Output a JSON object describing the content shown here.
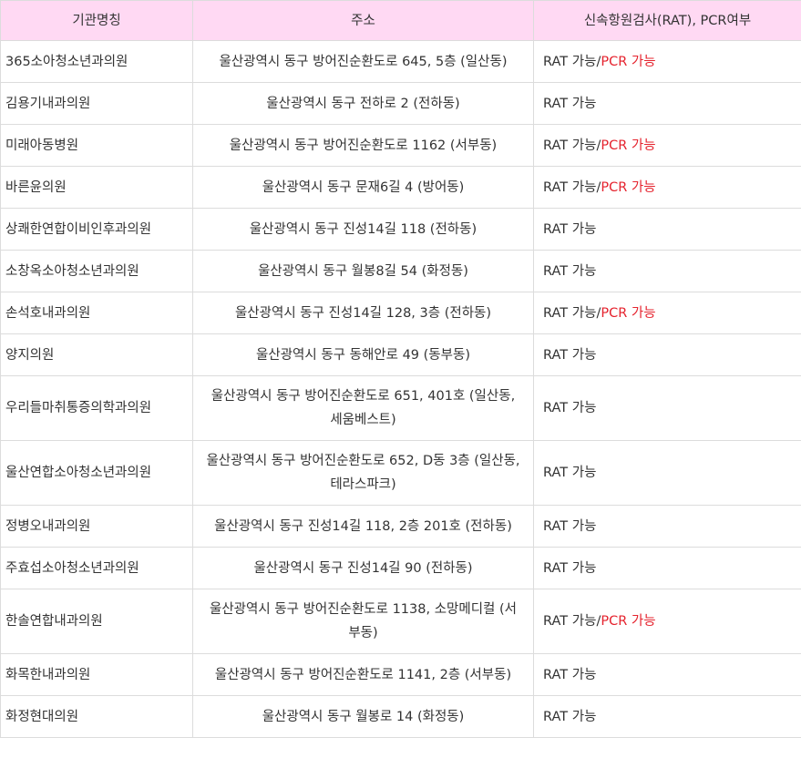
{
  "table": {
    "headers": [
      "기관명칭",
      "주소",
      "신속항원검사(RAT), PCR여부"
    ],
    "rows": [
      {
        "name": "365소아청소년과의원",
        "address": "울산광역시 동구 방어진순환도로 645, 5층 (일산동)",
        "rat": "RAT 가능",
        "sep": "/",
        "pcr": "PCR 가능"
      },
      {
        "name": "김용기내과의원",
        "address": "울산광역시 동구 전하로 2 (전하동)",
        "rat": "RAT 가능",
        "sep": "",
        "pcr": ""
      },
      {
        "name": "미래아동병원",
        "address": "울산광역시 동구 방어진순환도로 1162 (서부동)",
        "rat": "RAT 가능",
        "sep": "/",
        "pcr": "PCR 가능"
      },
      {
        "name": "바른윤의원",
        "address": "울산광역시 동구 문재6길 4 (방어동)",
        "rat": "RAT 가능",
        "sep": "/",
        "pcr": "PCR 가능"
      },
      {
        "name": "상쾌한연합이비인후과의원",
        "address": "울산광역시 동구 진성14길 118 (전하동)",
        "rat": "RAT 가능",
        "sep": "",
        "pcr": ""
      },
      {
        "name": "소창옥소아청소년과의원",
        "address": "울산광역시 동구 월봉8길 54 (화정동)",
        "rat": "RAT 가능",
        "sep": "",
        "pcr": ""
      },
      {
        "name": "손석호내과의원",
        "address": "울산광역시 동구 진성14길 128, 3층 (전하동)",
        "rat": "RAT 가능",
        "sep": "/",
        "pcr": "PCR 가능"
      },
      {
        "name": "양지의원",
        "address": "울산광역시 동구 동해안로 49 (동부동)",
        "rat": "RAT 가능",
        "sep": "",
        "pcr": ""
      },
      {
        "name": "우리들마취통증의학과의원",
        "address": "울산광역시 동구 방어진순환도로 651, 401호 (일산동, 세움베스트)",
        "rat": "RAT 가능",
        "sep": "",
        "pcr": ""
      },
      {
        "name": "울산연합소아청소년과의원",
        "address": "울산광역시 동구 방어진순환도로 652, D동 3층 (일산동, 테라스파크)",
        "rat": "RAT 가능",
        "sep": "",
        "pcr": ""
      },
      {
        "name": "정병오내과의원",
        "address": "울산광역시 동구 진성14길 118, 2층 201호 (전하동)",
        "rat": "RAT 가능",
        "sep": "",
        "pcr": ""
      },
      {
        "name": "주효섭소아청소년과의원",
        "address": "울산광역시 동구 진성14길 90 (전하동)",
        "rat": "RAT 가능",
        "sep": "",
        "pcr": ""
      },
      {
        "name": "한솔연합내과의원",
        "address": "울산광역시 동구 방어진순환도로 1138, 소망메디컬 (서부동)",
        "rat": "RAT 가능",
        "sep": "/",
        "pcr": "PCR 가능"
      },
      {
        "name": "화목한내과의원",
        "address": "울산광역시 동구 방어진순환도로 1141, 2층 (서부동)",
        "rat": "RAT 가능",
        "sep": "",
        "pcr": ""
      },
      {
        "name": "화정현대의원",
        "address": "울산광역시 동구 월봉로 14 (화정동)",
        "rat": "RAT 가능",
        "sep": "",
        "pcr": ""
      }
    ]
  },
  "colors": {
    "header_background": "#ffd9f3",
    "pcr_text": "#e5232e",
    "border": "#dcdcdc"
  }
}
